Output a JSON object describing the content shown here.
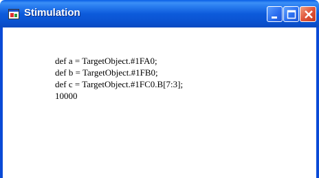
{
  "window": {
    "title": "Stimulation",
    "icon": "app-window-icon",
    "controls": {
      "minimize_icon": "minimize-icon",
      "maximize_icon": "maximize-icon",
      "close_icon": "close-icon"
    }
  },
  "content": {
    "lines": [
      "def a = TargetObject.#1FA0;",
      "def b = TargetObject.#1FB0;",
      "def c = TargetObject.#1FC0.B[7:3];",
      "10000"
    ]
  },
  "colors": {
    "titlebar": "#0a5fe6",
    "frame": "#0a4ad6",
    "close_button": "#e0553a",
    "background": "#ffffff"
  }
}
